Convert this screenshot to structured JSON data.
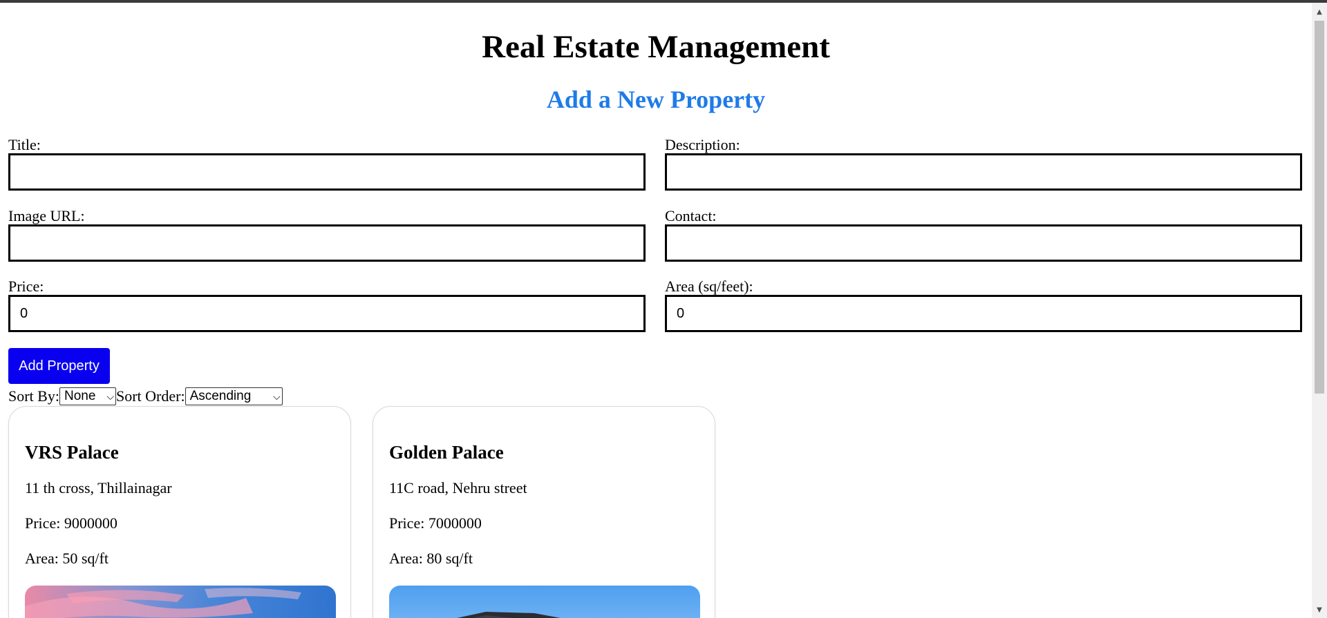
{
  "header": {
    "title": "Real Estate Management",
    "subtitle": "Add a New Property"
  },
  "form": {
    "title_label": "Title:",
    "title_value": "",
    "description_label": "Description:",
    "description_value": "",
    "image_url_label": "Image URL:",
    "image_url_value": "",
    "contact_label": "Contact:",
    "contact_value": "",
    "price_label": "Price:",
    "price_value": "0",
    "area_label": "Area (sq/feet):",
    "area_value": "0",
    "submit_label": "Add Property"
  },
  "sort": {
    "sort_by_label": "Sort By:",
    "sort_by_value": "None",
    "sort_order_label": "Sort Order:",
    "sort_order_value": "Ascending"
  },
  "properties": [
    {
      "title": "VRS Palace",
      "description": "11 th cross, Thillainagar",
      "price": "Price: 9000000",
      "area": "Area: 50 sq/ft",
      "image": "sunset-sky-photo"
    },
    {
      "title": "Golden Palace",
      "description": "11C road, Nehru street",
      "price": "Price: 7000000",
      "area": "Area: 80 sq/ft",
      "image": "house-blue-sky-photo"
    }
  ],
  "colors": {
    "accent_heading": "#1e7be8",
    "button": "#0a00f0"
  },
  "icons": {
    "select_arrow": "chevron-down-icon",
    "scroll_up": "scroll-up-arrow-icon",
    "scroll_down": "scroll-down-arrow-icon"
  }
}
